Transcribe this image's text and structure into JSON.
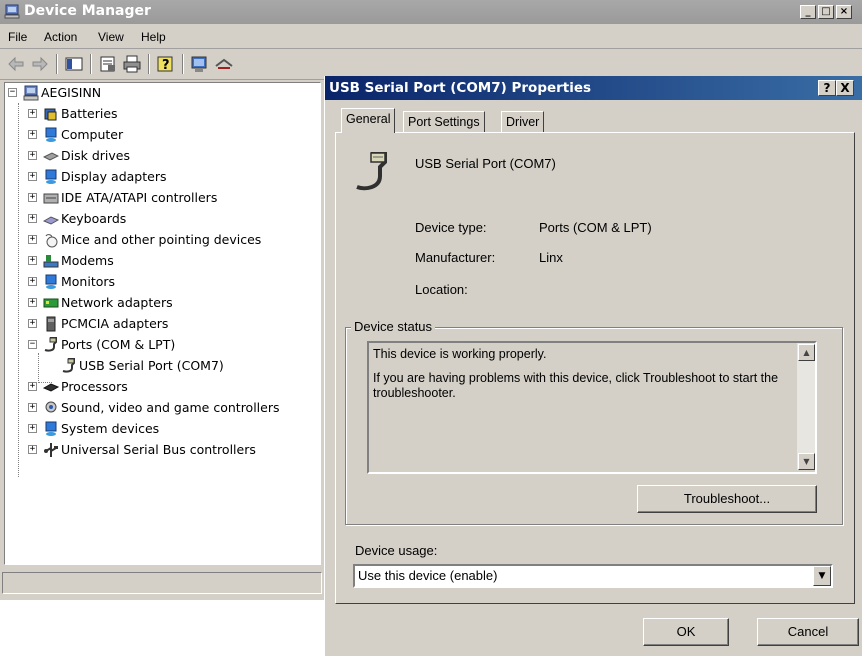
{
  "device_manager": {
    "title": "Device Manager",
    "menu": [
      "File",
      "Action",
      "View",
      "Help"
    ],
    "tree": {
      "root": "AEGISINN",
      "categories": [
        {
          "label": "Batteries",
          "icon": "battery-icon"
        },
        {
          "label": "Computer",
          "icon": "computer-icon"
        },
        {
          "label": "Disk drives",
          "icon": "disk-drive-icon"
        },
        {
          "label": "Display adapters",
          "icon": "display-adapter-icon"
        },
        {
          "label": "IDE ATA/ATAPI controllers",
          "icon": "ide-controller-icon"
        },
        {
          "label": "Keyboards",
          "icon": "keyboard-icon"
        },
        {
          "label": "Mice and other pointing devices",
          "icon": "mouse-icon"
        },
        {
          "label": "Modems",
          "icon": "modem-icon"
        },
        {
          "label": "Monitors",
          "icon": "monitor-icon"
        },
        {
          "label": "Network adapters",
          "icon": "network-adapter-icon"
        },
        {
          "label": "PCMCIA adapters",
          "icon": "pcmcia-icon"
        },
        {
          "label": "Ports (COM & LPT)",
          "icon": "port-icon",
          "expanded": true
        },
        {
          "label": "USB Serial Port (COM7)",
          "icon": "port-icon",
          "child": true
        },
        {
          "label": "Processors",
          "icon": "processor-icon"
        },
        {
          "label": "Sound, video and game controllers",
          "icon": "sound-icon"
        },
        {
          "label": "System devices",
          "icon": "system-device-icon"
        },
        {
          "label": "Universal Serial Bus controllers",
          "icon": "usb-icon"
        }
      ]
    }
  },
  "dialog": {
    "title": "USB Serial Port (COM7) Properties",
    "help_label": "?",
    "close_label": "X",
    "tabs": [
      "General",
      "Port Settings",
      "Driver"
    ],
    "active_tab": "General",
    "device_name": "USB Serial Port (COM7)",
    "props": {
      "device_type_label": "Device type:",
      "device_type_value": "Ports (COM & LPT)",
      "manufacturer_label": "Manufacturer:",
      "manufacturer_value": "Linx",
      "location_label": "Location:",
      "location_value": ""
    },
    "status": {
      "legend": "Device status",
      "line1": "This device is working properly.",
      "line2": "If you are having problems with this device, click Troubleshoot to start the troubleshooter.",
      "troubleshoot_label": "Troubleshoot..."
    },
    "usage": {
      "label": "Device usage:",
      "selected": "Use this device (enable)"
    },
    "ok_label": "OK",
    "cancel_label": "Cancel"
  },
  "colors": {
    "dialog_title_bar": "#0a246a",
    "inactive_title_bar": "#a0a0a0",
    "window_face": "#d4d0c8"
  }
}
